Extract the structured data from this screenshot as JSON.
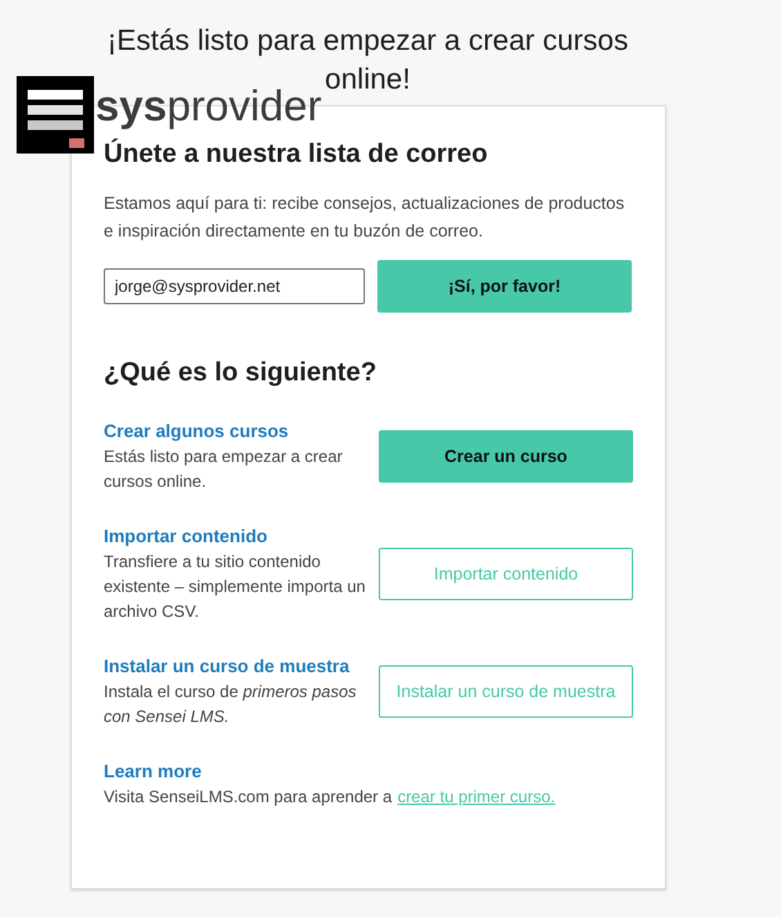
{
  "heading": "¡Estás listo para empezar a crear cursos online!",
  "logo": {
    "text": "**sys**provider"
  },
  "mailing": {
    "title": "Únete a nuestra lista de correo",
    "text": "Estamos aquí para ti: recibe consejos, actualizaciones de productos e inspiración directamente en tu buzón de correo.",
    "email": "jorge@sysprovider.net",
    "button": "¡Sí, por favor!"
  },
  "next": {
    "title": "¿Qué es lo siguiente?",
    "items": [
      {
        "title": "Crear algunos cursos",
        "text": "Estás listo para empezar a crear cursos online.",
        "button": {
          "label": "Crear un curso",
          "kind": "primary"
        }
      },
      {
        "title": "Importar contenido",
        "text": "Transfiere a tu sitio contenido existente – simplemente importa un archivo CSV.",
        "button": {
          "label": "Importar contenido",
          "kind": "secondary"
        }
      },
      {
        "title": "Instalar un curso de muestra",
        "text": "Instala el curso de *primeros pasos con Sensei LMS.*",
        "button": {
          "label": "Instalar un curso de muestra",
          "kind": "secondary"
        }
      },
      {
        "title": "Learn more",
        "text": "Visita SenseiLMS.com para aprender a",
        "link": "crear tu primer curso."
      }
    ]
  }
}
